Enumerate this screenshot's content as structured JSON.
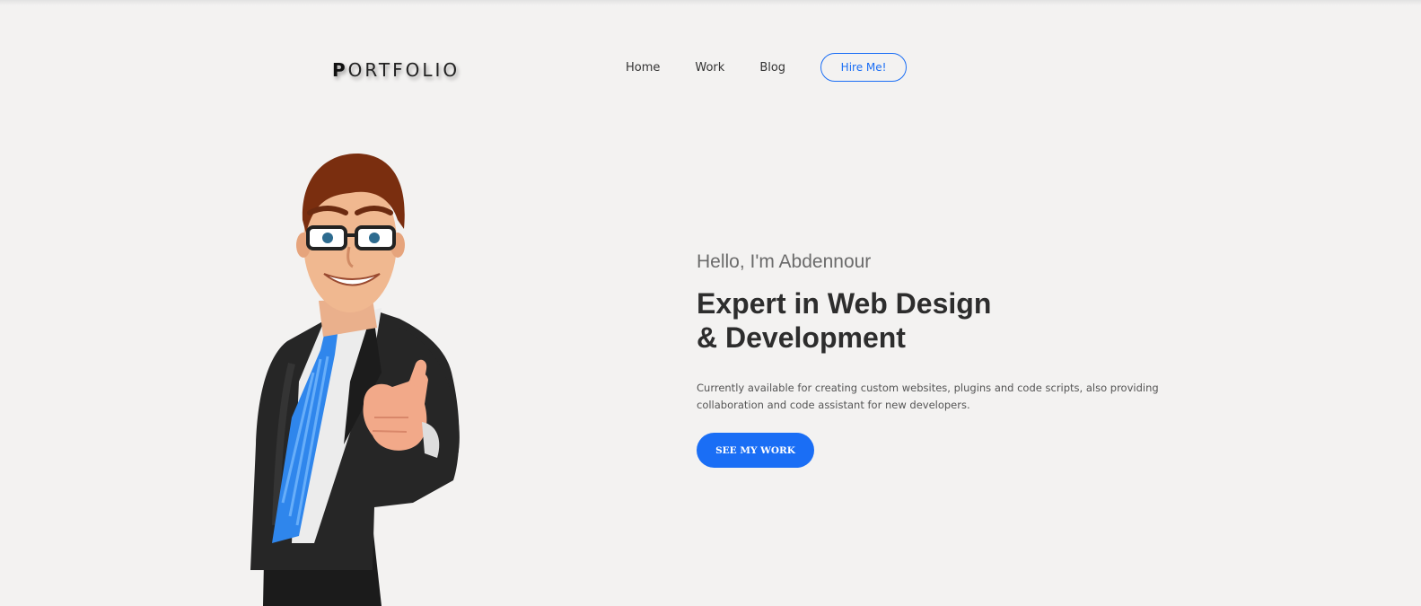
{
  "header": {
    "logo_first": "P",
    "logo_rest": "ORTFOLIO",
    "nav": [
      {
        "label": "Home"
      },
      {
        "label": "Work"
      },
      {
        "label": "Blog"
      }
    ],
    "hire_label": "Hire Me!"
  },
  "hero": {
    "greeting": "Hello, I'm Abdennour",
    "headline": "Expert in Web Design & Development",
    "description": "Currently available for creating custom websites, plugins and code scripts, also providing collaboration and code assistant for new developers.",
    "cta_label": "SEE MY WORK",
    "illustration": "cartoon-businessman-pointing"
  },
  "colors": {
    "accent": "#1a6ef5",
    "background": "#f3f2f1",
    "heading": "#2d2d2d"
  }
}
